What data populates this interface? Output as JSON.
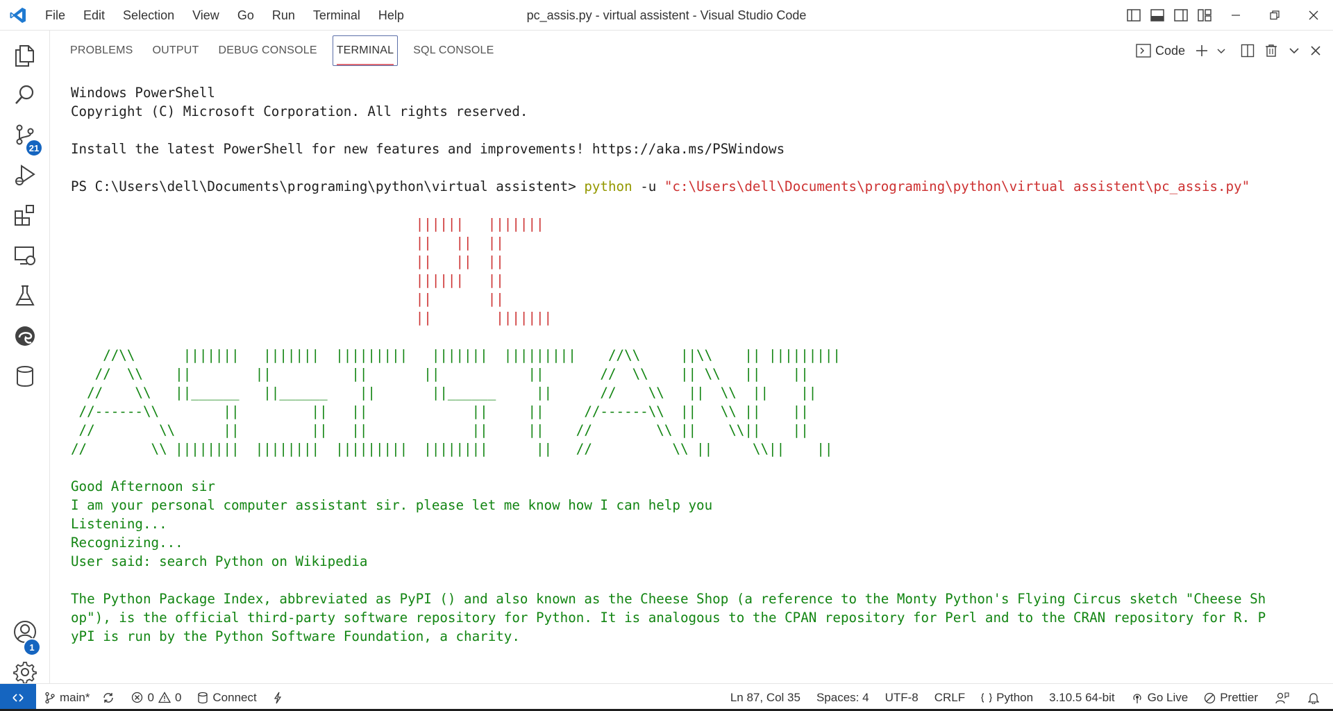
{
  "titlebar": {
    "title": "pc_assis.py - virtual assistent - Visual Studio Code",
    "menu": [
      "File",
      "Edit",
      "Selection",
      "View",
      "Go",
      "Run",
      "Terminal",
      "Help"
    ]
  },
  "activitybar": {
    "source_control_badge": "21",
    "accounts_badge": "1"
  },
  "panel": {
    "tabs": [
      "PROBLEMS",
      "OUTPUT",
      "DEBUG CONSOLE",
      "TERMINAL",
      "SQL CONSOLE"
    ],
    "active_tab": "TERMINAL",
    "terminal_profile": "Code"
  },
  "terminal": {
    "banner_line1": "Windows PowerShell",
    "banner_line2": "Copyright (C) Microsoft Corporation. All rights reserved.",
    "install_hint": "Install the latest PowerShell for new features and improvements! https://aka.ms/PSWindows",
    "prompt": "PS C:\\Users\\dell\\Documents\\programing\\python\\virtual assistent> ",
    "command": "python",
    "command_flag": " -u ",
    "command_arg": "\"c:\\Users\\dell\\Documents\\programing\\python\\virtual assistent\\pc_assis.py\"",
    "ascii_pc": [
      "                                           ||||||   |||||||",
      "                                           ||   ||  ||",
      "                                           ||   ||  ||",
      "                                           ||||||   ||",
      "                                           ||       ||",
      "                                           ||        |||||||"
    ],
    "ascii_assistant": [
      "    //\\\\      |||||||   |||||||  |||||||||   |||||||  |||||||||    //\\\\     ||\\\\    || |||||||||",
      "   //  \\\\    ||        ||          ||       ||           ||       //  \\\\    || \\\\   ||    ||",
      "  //    \\\\   ||______   ||______    ||       ||______     ||      //    \\\\   ||  \\\\  ||    ||",
      " //------\\\\        ||         ||   ||             ||     ||     //------\\\\  ||   \\\\ ||    ||",
      " //        \\\\      ||         ||   ||             ||     ||    //        \\\\ ||    \\\\||    ||",
      "//        \\\\ ||||||||  ||||||||  |||||||||  ||||||||      ||   //          \\\\ ||     \\\\||    ||"
    ],
    "output_lines": [
      "Good Afternoon sir",
      "I am your personal computer assistant sir. please let me know how I can help you",
      "Listening...",
      "Recognizing...",
      "User said: search Python on Wikipedia"
    ],
    "wiki_lines": [
      "The Python Package Index, abbreviated as PyPI () and also known as the Cheese Shop (a reference to the Monty Python's Flying Circus sketch \"Cheese Sh",
      "op\"), is the official third-party software repository for Python. It is analogous to the CPAN repository for Perl and to the CRAN repository for R. P",
      "yPI is run by the Python Software Foundation, a charity."
    ]
  },
  "statusbar": {
    "branch": "main*",
    "errors": "0",
    "warnings": "0",
    "connect": "Connect",
    "cursor": "Ln 87, Col 35",
    "spaces": "Spaces: 4",
    "encoding": "UTF-8",
    "eol": "CRLF",
    "language": "Python",
    "interpreter": "3.10.5 64-bit",
    "go_live": "Go Live",
    "prettier": "Prettier"
  },
  "colors": {
    "accent": "#1565c0",
    "terminal_green": "#128512",
    "terminal_red": "#cd3131",
    "terminal_yellow": "#949800"
  }
}
